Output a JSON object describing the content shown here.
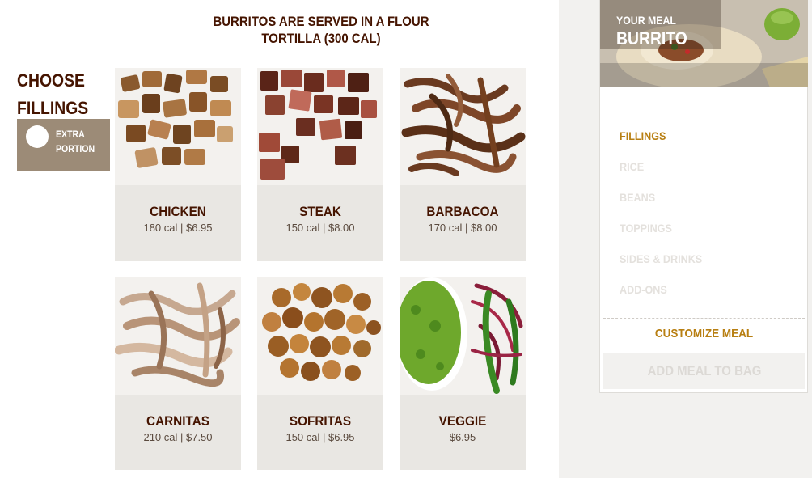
{
  "header": {
    "note_line1": "BURRITOS ARE SERVED IN A FLOUR",
    "note_line2": "TORTILLA (300 CAL)"
  },
  "section": {
    "title_line1": "CHOOSE",
    "title_line2": "FILLINGS",
    "extra_line1": "EXTRA",
    "extra_line2": "PORTION"
  },
  "fillings": [
    {
      "name": "CHICKEN",
      "info": "180 cal | $6.95"
    },
    {
      "name": "STEAK",
      "info": "150 cal | $8.00"
    },
    {
      "name": "BARBACOA",
      "info": "170 cal | $8.00"
    },
    {
      "name": "CARNITAS",
      "info": "210 cal | $7.50"
    },
    {
      "name": "SOFRITAS",
      "info": "150 cal | $6.95"
    },
    {
      "name": "VEGGIE",
      "info": "$6.95"
    }
  ],
  "meal": {
    "label": "YOUR MEAL",
    "name": "BURRITO",
    "steps": [
      "FILLINGS",
      "RICE",
      "BEANS",
      "TOPPINGS",
      "SIDES & DRINKS",
      "ADD-ONS"
    ],
    "active_step": "FILLINGS",
    "customize_label": "CUSTOMIZE MEAL",
    "add_to_bag_label": "ADD MEAL TO BAG"
  },
  "colors": {
    "brand_brown": "#451400",
    "accent_gold": "#b87f12",
    "toggle_bg": "#9c8b77",
    "tile_bg": "#e9e7e3"
  }
}
